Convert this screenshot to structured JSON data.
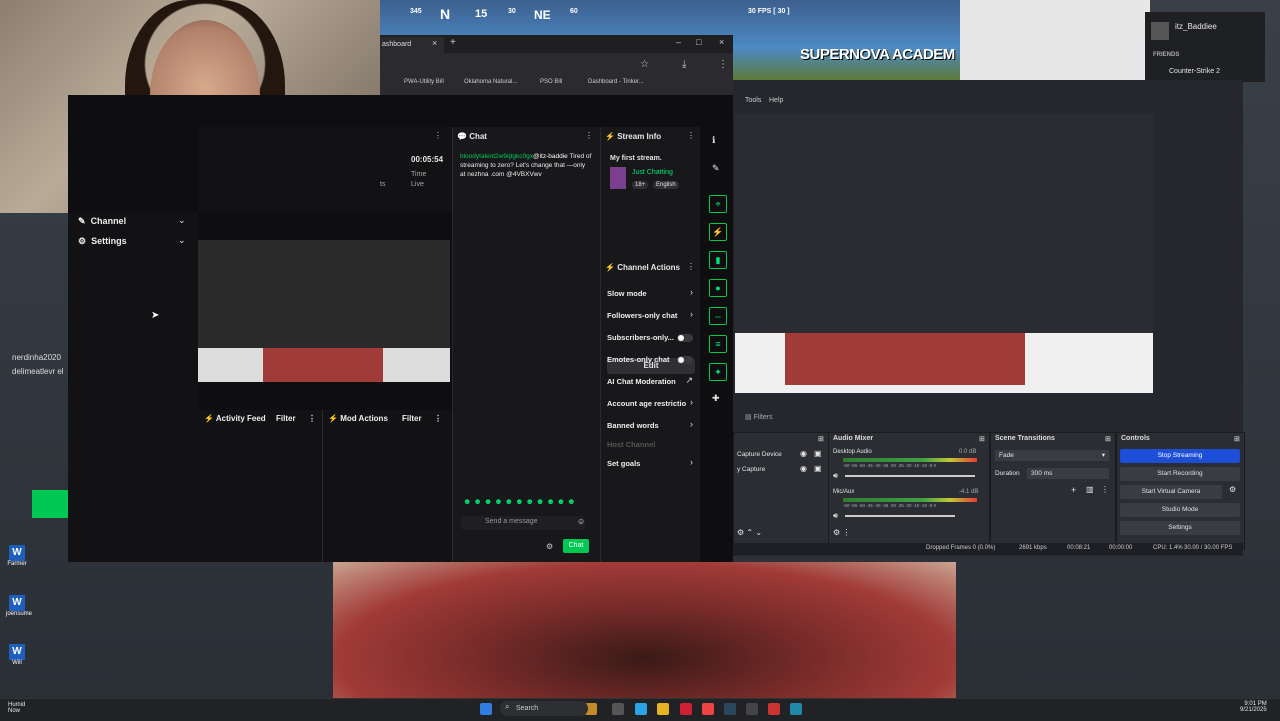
{
  "game_hud": {
    "heading_a": "345",
    "heading_n": "N",
    "heading_15": "15",
    "heading_30": "30",
    "heading_ne": "NE",
    "heading_60": "60",
    "fps": "30 FPS [ 30 ]",
    "banner": "SUPERNOVA ACADEM"
  },
  "browser": {
    "tab_title": "ashboard",
    "bookmarks": [
      "PWA-Utility Bill",
      "Oklahoma Natural...",
      "PSO Bill",
      "Dashboard - Tinker..."
    ]
  },
  "sidebar": {
    "channel_label": "Channel",
    "settings_label": "Settings"
  },
  "overflow_names": [
    "nerdinha2020",
    "delimeatlevr el"
  ],
  "stream_stats": {
    "time_value": "00:05:54",
    "time_label": "Time",
    "live_label": "Live",
    "left_fragment": "ts"
  },
  "panels": {
    "activity_feed": "Activity Feed",
    "activity_filter": "Filter",
    "mod_actions": "Mod Actions",
    "mod_filter": "Filter"
  },
  "chat": {
    "title": "Chat",
    "message_user": "bloodytalent2w9qtgkc0gx",
    "message_mention": "@itz-baddie",
    "message_text": "Tired of streaming to zero? Let's change that —only at nezhna .com @4VBXVwv",
    "input_placeholder": "Send a message",
    "send_label": "Chat"
  },
  "stream_info": {
    "title": "Stream Info",
    "stream_title": "My first stream.",
    "category": "Just Chatting",
    "tag_age": "18+",
    "tag_lang": "English",
    "edit_label": "Edit"
  },
  "channel_actions": {
    "title": "Channel Actions",
    "items": [
      "Slow mode",
      "Followers-only chat",
      "Subscribers-only...",
      "Emotes-only chat",
      "AI Chat Moderation",
      "Account age restrictio",
      "Banned words",
      "Host Channel",
      "Set goals"
    ]
  },
  "obs": {
    "menu_tools": "Tools",
    "menu_help": "Help",
    "filters_label": "Filters",
    "sources": [
      "Capture Device",
      "y Capture"
    ],
    "audio_mixer": "Audio Mixer",
    "desktop_audio": "Desktop Audio",
    "desktop_db": "0.0 dB",
    "mic_aux": "Mic/Aux",
    "mic_db": "-4.1 dB",
    "scale_ticks": "-60 -55 -50 -45 -40 -35 -30 -25 -20 -15 -10 -5 0",
    "scene_transitions": "Scene Transitions",
    "transition": "Fade",
    "duration_label": "Duration",
    "duration_value": "300 ms",
    "controls": "Controls",
    "buttons": [
      "Stop Streaming",
      "Start Recording",
      "Start Virtual Camera",
      "Studio Mode",
      "Settings"
    ],
    "status": {
      "dropped": "Dropped Frames 0 (0.0%)",
      "kbps": "2691 kbps",
      "live_time": "00:08:21",
      "rec_time": "00:00:00",
      "cpu": "CPU: 1.4%",
      "fps": "30.00 / 30.00 FPS"
    }
  },
  "friends": {
    "username": "itz_Baddiee",
    "label": "FRIENDS",
    "game": "Counter-Strike 2"
  },
  "desktop_icons": [
    "Farmer",
    "joensume",
    "Will"
  ],
  "taskbar": {
    "weather_line1": "Humid",
    "weather_line2": "Now",
    "search": "Search",
    "time": "9:01 PM",
    "date": "9/21/2025"
  },
  "colors": {
    "accent_green": "#00c853",
    "twitch_bg": "#0e0e10",
    "obs_blue": "#1c4ed8"
  }
}
